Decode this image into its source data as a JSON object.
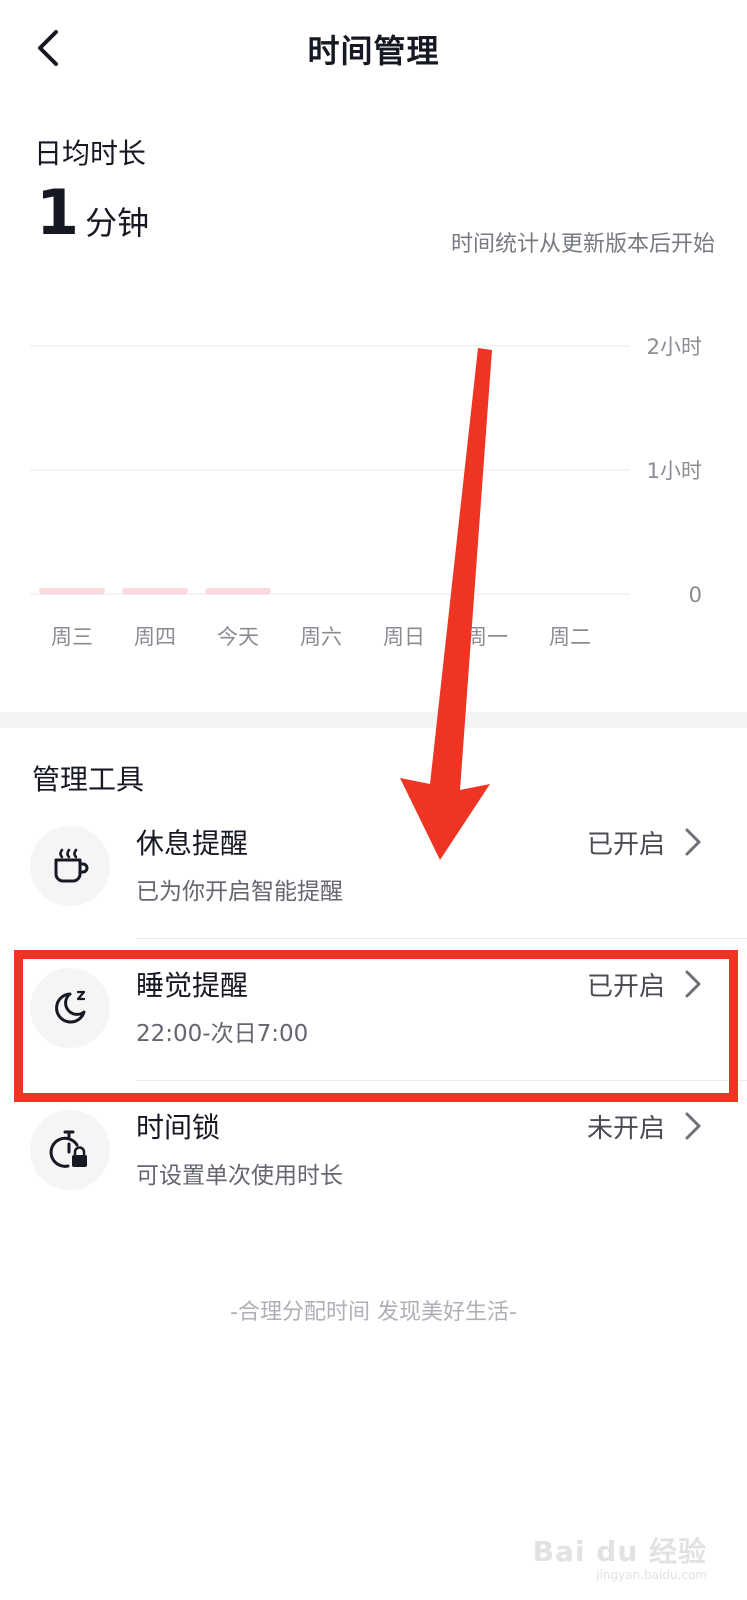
{
  "header": {
    "title": "时间管理"
  },
  "summary": {
    "label": "日均时长",
    "value": "1",
    "unit": "分钟",
    "note": "时间统计从更新版本后开始"
  },
  "chart_data": {
    "type": "bar",
    "categories": [
      "周三",
      "周四",
      "今天",
      "周六",
      "周日",
      "周一",
      "周二"
    ],
    "values": [
      0.01,
      0.02,
      0.02,
      0,
      0,
      0,
      0
    ],
    "ylim": [
      0,
      2
    ],
    "y_ticks": [
      {
        "value": 2,
        "label": "2小时"
      },
      {
        "value": 1,
        "label": "1小时"
      },
      {
        "value": 0,
        "label": "0"
      }
    ],
    "bar_color": "#fe2c55",
    "grid": true
  },
  "tools": {
    "title": "管理工具",
    "items": [
      {
        "name": "休息提醒",
        "desc": "已为你开启智能提醒",
        "status": "已开启",
        "icon": "coffee-cup-icon"
      },
      {
        "name": "睡觉提醒",
        "desc": "22:00-次日7:00",
        "status": "已开启",
        "icon": "moon-sleep-icon"
      },
      {
        "name": "时间锁",
        "desc": "可设置单次使用时长",
        "status": "未开启",
        "icon": "timer-lock-icon"
      }
    ]
  },
  "footer": {
    "slogan": "-合理分配时间 发现美好生活-"
  },
  "annotation": {
    "color": "#ee3423"
  },
  "watermark": {
    "text": "Bai du 经验",
    "sub": "jingyan.baidu.com"
  }
}
